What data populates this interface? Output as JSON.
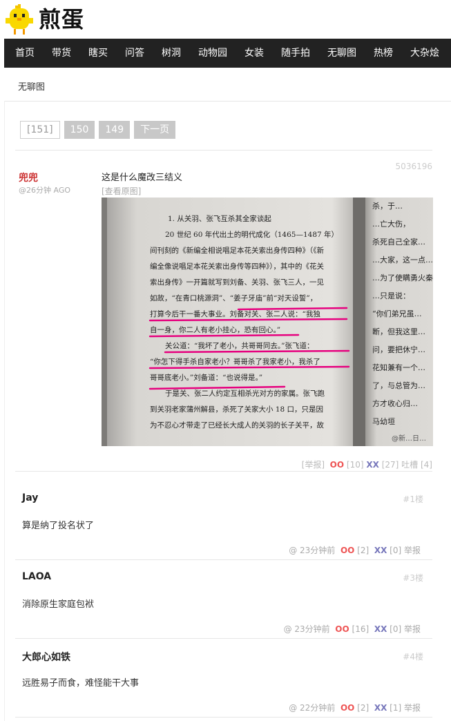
{
  "site": {
    "logo_text": "煎蛋"
  },
  "nav": [
    "首页",
    "带货",
    "瞎买",
    "问答",
    "树洞",
    "动物园",
    "女装",
    "随手拍",
    "无聊图",
    "热榜",
    "大杂烩"
  ],
  "breadcrumb": "无聊图",
  "pager": {
    "current": "[151]",
    "p1": "150",
    "p2": "149",
    "next": "下一页"
  },
  "post": {
    "author": "兜兜",
    "ago": "@26分钟 AGO",
    "id": "5036196",
    "title": "这是什么魔改三结义",
    "view_original": "[查看原图]",
    "report": "[举报]",
    "oo_label": "OO",
    "oo": "[10]",
    "xx_label": "XX",
    "xx": "[27]",
    "tucao": "吐槽 [4]"
  },
  "photo": {
    "left_lines": [
      "1. 从关羽、张飞互杀其全家谈起",
      "20 世纪 60 年代出土的明代成化（1465—1487 年）",
      "间刊刻的《新编全相说唱足本花关索出身传四种》（《新",
      "编全像说唱足本花关索出身传等四种》），其中的《花关",
      "索出身传》一开篇就写到刘备、关羽、张飞三人，一见",
      "如故，“在青口桃源洞”、“姜子牙庙”前“对天设誓”，",
      "打算今后干一番大事业。刘备对关、张二人说：“我独",
      "自一身，你二人有老小挂心，恐有回心。”",
      "关公道：“我坏了老小，共哥哥同去。”张飞道：",
      "“你怎下得手杀自家老小？哥哥杀了我家老小，我杀了",
      "哥哥底老小。”刘备道：“也说得是。”",
      "于是关、张二人约定互相杀光对方的家属。张飞跑",
      "到关羽老家蒲州解县，杀死了关家大小 18 口，只是因",
      "为不忍心才带走了已经长大成人的关羽的长子关平，故"
    ],
    "right_lines": [
      "杀，于…",
      "…亡大伤，",
      "杀死自己全家…",
      "…大家，这一点…",
      "…为了使瞒勇火秦",
      "…只是说：",
      "“你们弟兄虽…",
      "断，但我这里…",
      "问，要把休宁…",
      "花知兼有一个…",
      "了，与总管为…",
      "方才收心归…",
      "马幼垣"
    ],
    "watermark": "@新…日…"
  },
  "comments": [
    {
      "name": "Jay",
      "floor": "#1楼",
      "text": "算是纳了投名状了",
      "time": "@ 23分钟前",
      "oo": "[2]",
      "xx": "[0]",
      "report": "举报"
    },
    {
      "name": "LAOA",
      "floor": "#3楼",
      "text": "消除原生家庭包袱",
      "time": "@ 23分钟前",
      "oo": "[16]",
      "xx": "[0]",
      "report": "举报"
    },
    {
      "name": "大郎心如铁",
      "floor": "#4楼",
      "text": "远胜易子而食，难怪能干大事",
      "time": "@ 22分钟前",
      "oo": "[2]",
      "xx": "[1]",
      "report": "举报"
    }
  ],
  "labels": {
    "oo": "OO",
    "xx": "XX"
  },
  "colors": {
    "nav_bg": "#222222",
    "author": "#cc3333",
    "oo": "#ee5555",
    "xx": "#7777bb",
    "highlight": "#e6007e"
  }
}
